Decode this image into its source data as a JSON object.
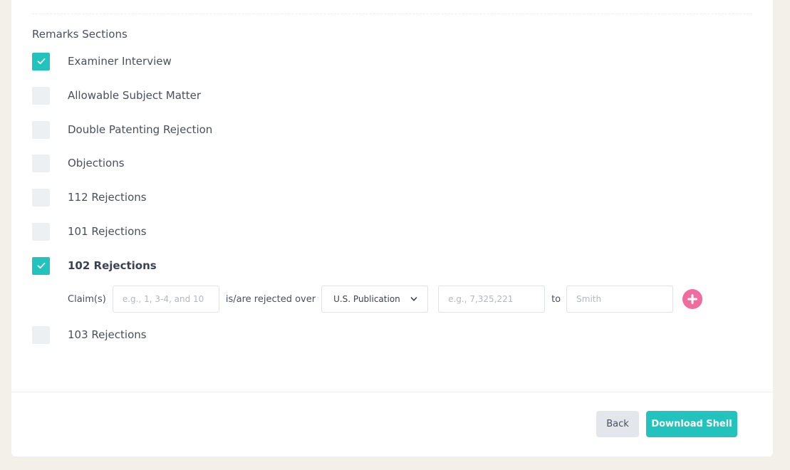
{
  "section_title": "Remarks Sections",
  "options": [
    {
      "label": "Examiner Interview",
      "checked": true
    },
    {
      "label": "Allowable Subject Matter",
      "checked": false
    },
    {
      "label": "Double Patenting Rejection",
      "checked": false
    },
    {
      "label": "Objections",
      "checked": false
    },
    {
      "label": "112 Rejections",
      "checked": false
    },
    {
      "label": "101 Rejections",
      "checked": false
    },
    {
      "label": "102 Rejections",
      "checked": true
    },
    {
      "label": "103 Rejections",
      "checked": false
    }
  ],
  "rejection_row": {
    "claims_label": "Claim(s)",
    "claims_placeholder": "e.g., 1, 3-4, and 10",
    "rejected_over_label": "is/are rejected over",
    "publication_type_selected": "U.S. Publication",
    "number_placeholder": "e.g., 7,325,221",
    "to_label": "to",
    "name_placeholder": "Smith"
  },
  "footer": {
    "back_label": "Back",
    "download_label": "Download Shell"
  },
  "colors": {
    "accent": "#22c3bc",
    "add": "#f06b9e",
    "page_bg": "#f3efe9"
  },
  "icons": {
    "check": "check-icon",
    "dropdown": "chevron-down-icon",
    "add": "plus-circle-icon"
  }
}
